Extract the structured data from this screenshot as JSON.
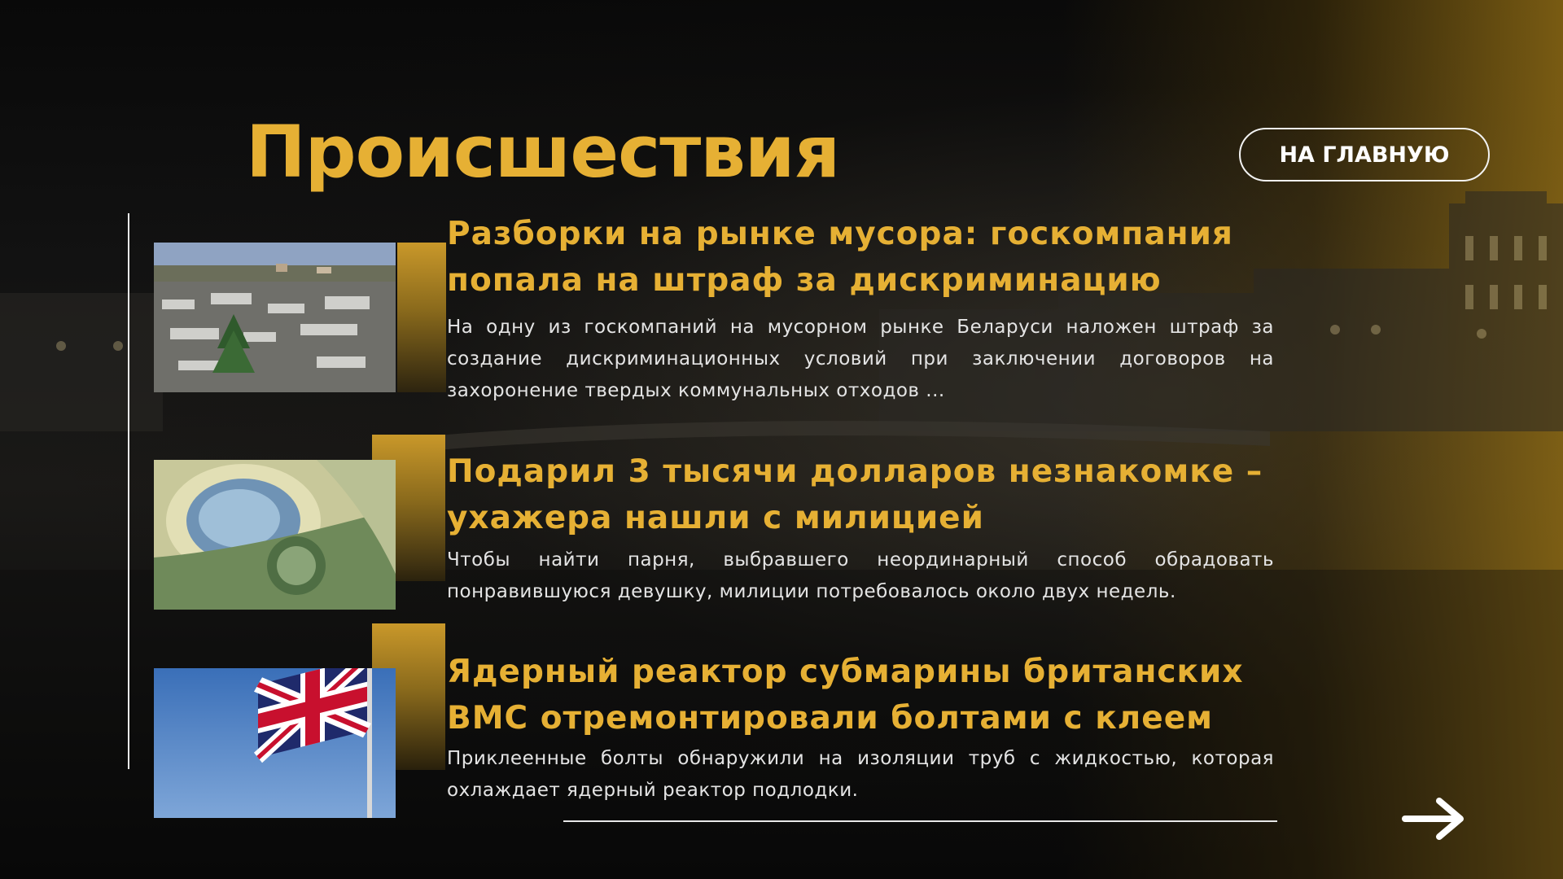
{
  "page": {
    "title": "Происшествия",
    "home_button_label": "НА ГЛАВНУЮ"
  },
  "articles": [
    {
      "headline_line1": "Разборки на рынке мусора: госкомпания",
      "headline_line2": "попала на штраф за дискриминацию",
      "excerpt": "На одну из госкомпаний на мусорном рынке Беларуси наложен штраф за создание дискриминационных условий при заключении договоров на захоронение твердых коммунальных отходов ...",
      "image_icon": "landfill-photo"
    },
    {
      "headline_line1": "Подарил 3 тысячи долларов незнакомке –",
      "headline_line2": "ухажера нашли с милицией",
      "excerpt": "Чтобы найти парня, выбравшего неординарный способ обрадовать понравившуюся девушку, милиции потребовалось около двух недель.",
      "image_icon": "dollar-bill-photo"
    },
    {
      "headline_line1": "Ядерный реактор субмарины британских",
      "headline_line2": "ВМС отремонтировали болтами с клеем",
      "excerpt": "Приклеенные болты обнаружили на изоляции труб с жидкостью, которая охлаждает ядерный реактор подлодки.",
      "image_icon": "union-jack-flag-photo"
    }
  ],
  "navigation": {
    "next_icon": "arrow-right-icon"
  },
  "colors": {
    "accent": "#e6b034",
    "text": "#e4e4e4",
    "background": "#0b0b0b"
  }
}
